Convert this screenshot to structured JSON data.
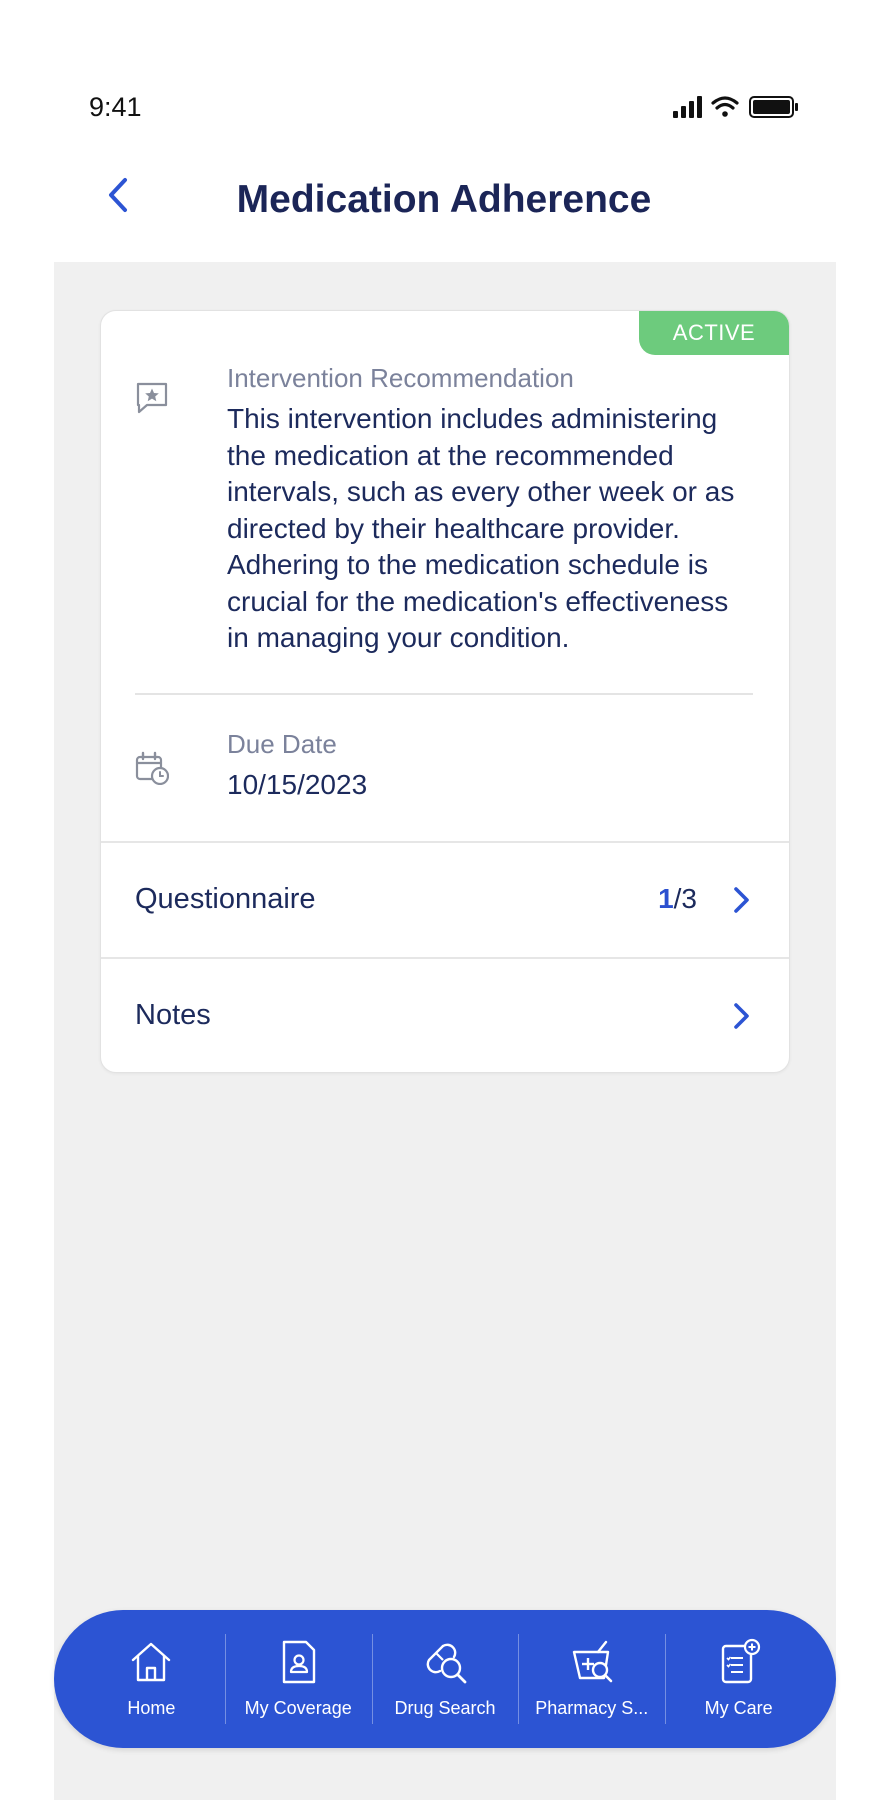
{
  "status_bar": {
    "time": "9:41",
    "icons": [
      "signal-icon",
      "wifi-icon",
      "battery-icon"
    ]
  },
  "header": {
    "back_icon": "chevron-left-icon",
    "title": "Medication Adherence"
  },
  "card": {
    "badge": "ACTIVE",
    "recommendation": {
      "icon": "message-star-icon",
      "label": "Intervention Recommendation",
      "text": "This intervention includes administering the medication at the recommended intervals, such as every other week or as directed by their healthcare provider. Adhering to the medication schedule is crucial for the medication's effectiveness in managing your condition."
    },
    "due_date": {
      "icon": "calendar-clock-icon",
      "label": "Due Date",
      "value": "10/15/2023"
    },
    "questionnaire": {
      "label": "Questionnaire",
      "current": "1",
      "separator": "/",
      "total": "3"
    },
    "notes": {
      "label": "Notes"
    }
  },
  "tab_bar": {
    "tabs": [
      {
        "label": "Home",
        "icon": "home-icon"
      },
      {
        "label": "My Coverage",
        "icon": "coverage-card-icon"
      },
      {
        "label": "Drug Search",
        "icon": "pill-search-icon"
      },
      {
        "label": "Pharmacy S...",
        "icon": "pharmacy-search-icon"
      },
      {
        "label": "My Care",
        "icon": "care-clipboard-icon"
      }
    ]
  },
  "colors": {
    "accent": "#2c54d3",
    "title": "#1b2557",
    "text": "#1c2a5c",
    "muted": "#7b829b",
    "badge": "#6dcb7d",
    "background": "#f0f0f0"
  }
}
